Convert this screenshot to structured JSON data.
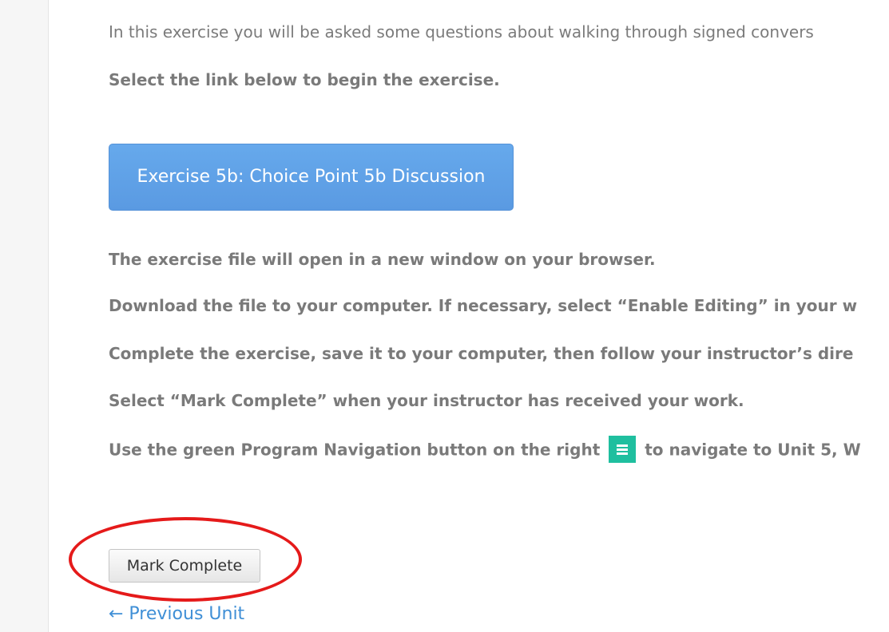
{
  "content": {
    "intro": "In this exercise you will be asked some questions about walking through signed convers",
    "select_link": "Select the link below to begin the exercise.",
    "exercise_button_label": "Exercise 5b: Choice Point 5b Discussion",
    "instructions": [
      "The exercise file will open in a new window on your browser.",
      "Download the file to your computer.  If necessary, select “Enable Editing” in your w",
      "Complete the exercise, save it to your computer, then follow your instructor’s dire",
      "Select “Mark Complete” when your instructor has received your work."
    ],
    "nav_instruction_before": "Use the green Program Navigation button on the right",
    "nav_instruction_after": "to navigate to Unit 5, W",
    "mark_complete_label": "Mark Complete",
    "previous_unit_label": "← Previous Unit"
  },
  "colors": {
    "exercise_button": "#5fa2e8",
    "nav_icon": "#1fbf9f",
    "highlight_ring": "#e51a1a",
    "link": "#3f8fd6"
  },
  "icons": {
    "nav_button": "menu-lines-icon"
  }
}
